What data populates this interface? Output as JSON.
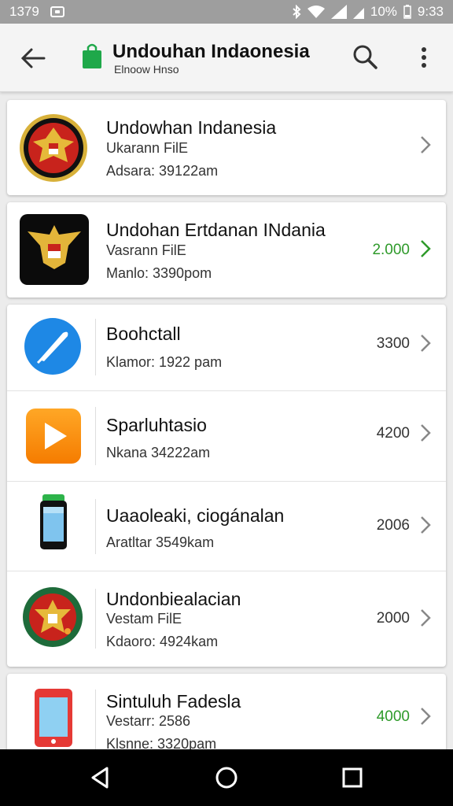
{
  "status_bar": {
    "time_left": "1379",
    "battery": "10%",
    "time_right": "9:33"
  },
  "app_bar": {
    "title": "Undouhan Indaonesia",
    "subtitle": "Elnoow Hnso",
    "icons": [
      "back-arrow-icon",
      "shopping-bag-icon",
      "search-icon",
      "more-vert-icon"
    ]
  },
  "items": [
    {
      "name": "Undowhan Indanesia",
      "line2": "Ukarann FilE",
      "line3": "Adsara: 39122am",
      "count": "",
      "icon": "garuda-emblem-icon"
    },
    {
      "name": "Undohan Ertdanan INdania",
      "line2": "Vasrann FilE",
      "line3": "Manlo: 3390pom",
      "count": "2.000",
      "count_color": "#2e9a2a",
      "icon": "garuda-black-tile-icon"
    },
    {
      "name": "Boohctall",
      "line2": "",
      "line3": "Klamor: 1922 pam",
      "count": "3300",
      "icon": "blue-feather-icon"
    },
    {
      "name": "Sparluhtasio",
      "line2": "",
      "line3": "Nkana 34222am",
      "count": "4200",
      "icon": "play-tile-icon"
    },
    {
      "name": "Uaaoleaki, ciogánalan",
      "line2": "",
      "line3": "Aratltar 3549kam",
      "count": "2006",
      "icon": "phone-battery-icon"
    },
    {
      "name": "Undonbiealacian",
      "line2": "Vestam FilE",
      "line3": "Kdaoro: 4924kam",
      "count": "2000",
      "icon": "garuda-green-circle-icon"
    },
    {
      "name": "Sintuluh Fadesla",
      "line2": "Vestarr: 2586",
      "line3": "Klsnne: 3320pam",
      "count": "4000",
      "count_color": "#2e9a2a",
      "icon": "red-tablet-icon"
    }
  ],
  "nav_bar": {
    "icons": [
      "nav-back-icon",
      "nav-home-icon",
      "nav-recents-icon"
    ]
  }
}
